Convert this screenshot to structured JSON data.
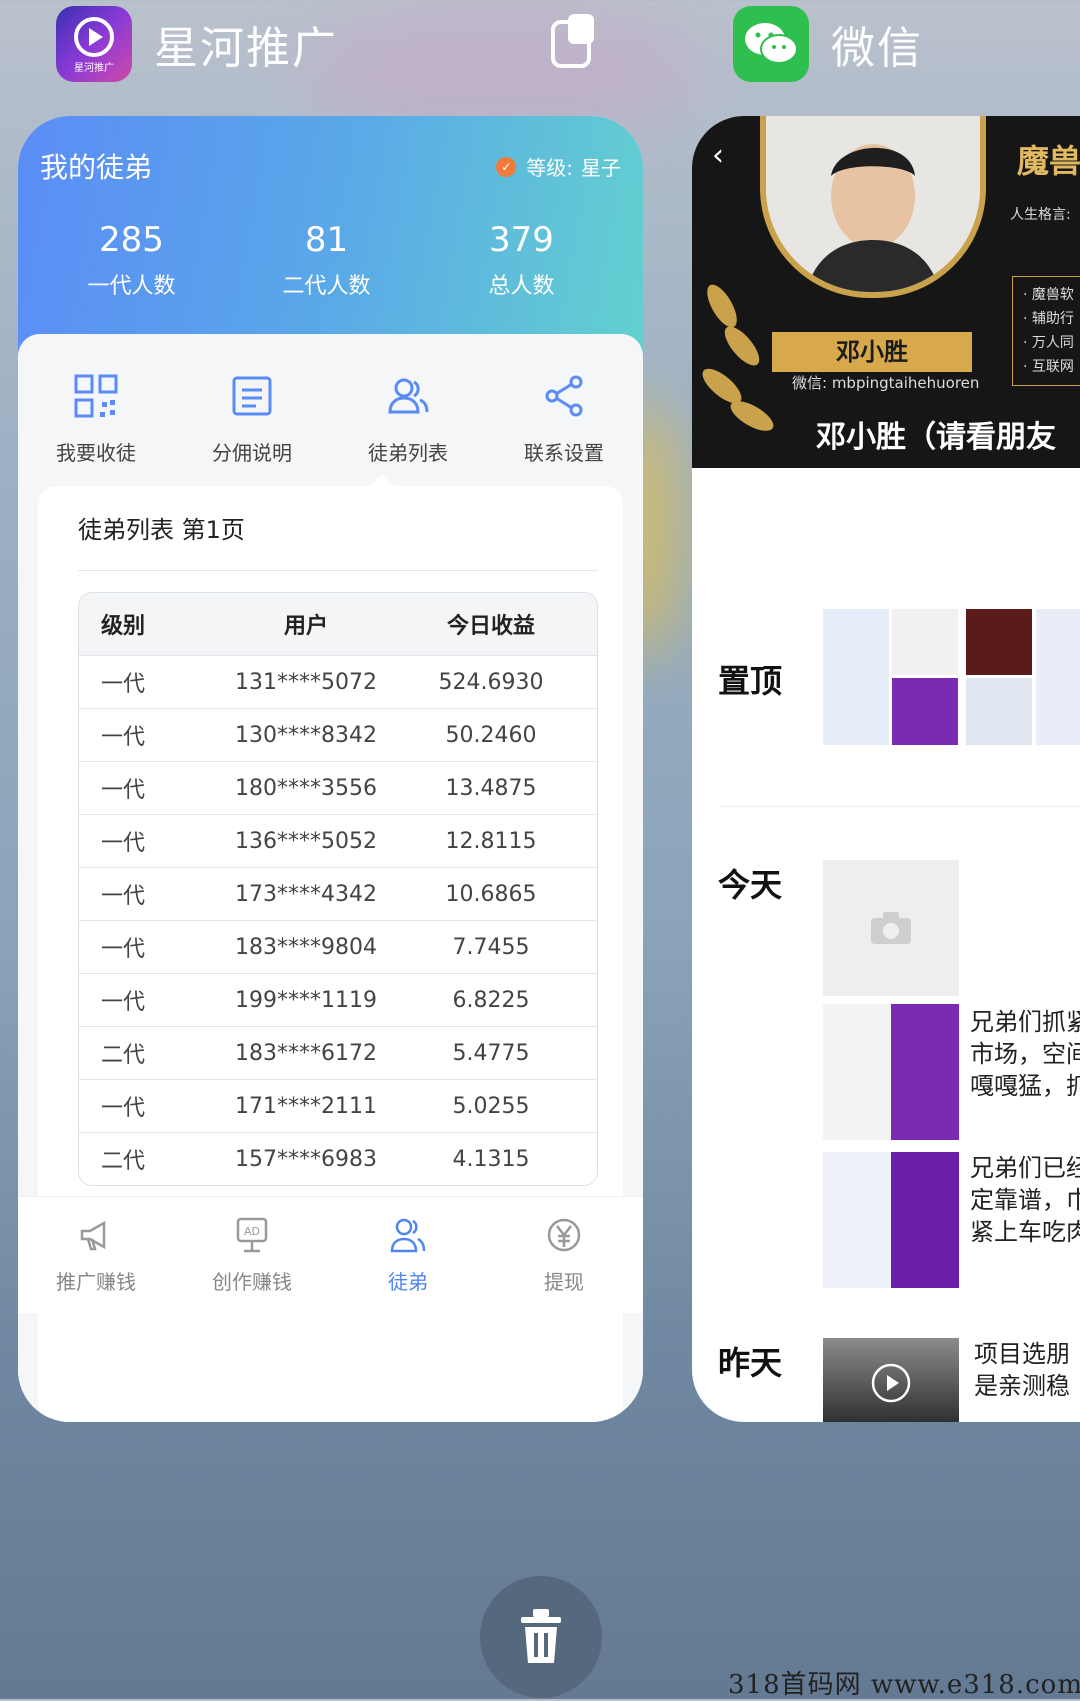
{
  "apps": {
    "left": {
      "name": "星河推广",
      "icon_caption": "星河推广"
    },
    "right": {
      "name": "微信"
    }
  },
  "xinghe": {
    "header": {
      "title": "我的徒弟",
      "level_label": "等级:",
      "level_value": "星子"
    },
    "stats": [
      {
        "value": "285",
        "label": "一代人数"
      },
      {
        "value": "81",
        "label": "二代人数"
      },
      {
        "value": "379",
        "label": "总人数"
      }
    ],
    "menu": [
      {
        "label": "我要收徒",
        "icon": "qr-code-icon"
      },
      {
        "label": "分佣说明",
        "icon": "document-icon"
      },
      {
        "label": "徒弟列表",
        "icon": "users-icon"
      },
      {
        "label": "联系设置",
        "icon": "share-icon"
      }
    ],
    "list_title": "徒弟列表 第1页",
    "table": {
      "headers": [
        "级别",
        "用户",
        "今日收益"
      ],
      "rows": [
        [
          "一代",
          "131****5072",
          "524.6930"
        ],
        [
          "一代",
          "130****8342",
          "50.2460"
        ],
        [
          "一代",
          "180****3556",
          "13.4875"
        ],
        [
          "一代",
          "136****5052",
          "12.8115"
        ],
        [
          "一代",
          "173****4342",
          "10.6865"
        ],
        [
          "一代",
          "183****9804",
          "7.7455"
        ],
        [
          "一代",
          "199****1119",
          "6.8225"
        ],
        [
          "二代",
          "183****6172",
          "5.4775"
        ],
        [
          "一代",
          "171****2111",
          "5.0255"
        ],
        [
          "二代",
          "157****6983",
          "4.1315"
        ]
      ]
    },
    "tabs": [
      {
        "label": "推广赚钱",
        "icon": "megaphone-icon",
        "active": false
      },
      {
        "label": "创作赚钱",
        "icon": "ad-board-icon",
        "active": false
      },
      {
        "label": "徒弟",
        "icon": "users-icon",
        "active": true
      },
      {
        "label": "提现",
        "icon": "yen-icon",
        "active": false
      }
    ],
    "accent": "#4f86f3"
  },
  "wechat": {
    "banner": {
      "title": "魔兽",
      "motto": "人生格言:",
      "list": [
        "· 魔兽软",
        "· 辅助行",
        "· 万人同",
        "· 互联网"
      ],
      "name_plate": "邓小胜",
      "wx_id": "微信: mbpingtaihehuoren",
      "caption": "邓小胜（请看朋友"
    },
    "sections": {
      "pinned": "置顶",
      "today": "今天",
      "yesterday": "昨天"
    },
    "moments": [
      {
        "lines": [
          "兄弟们抓紧",
          "市场，空间",
          "嘎嘎猛，抓"
        ]
      },
      {
        "lines": [
          "兄弟们已经",
          "定靠谱，巾",
          "紧上车吃肉"
        ]
      },
      {
        "lines": [
          "项目选朋",
          "是亲测稳"
        ]
      }
    ]
  },
  "watermark": "318首码网 www.e318.com"
}
